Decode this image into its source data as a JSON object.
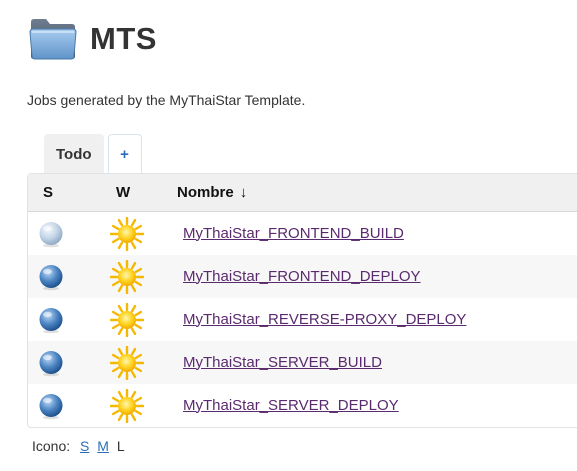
{
  "view": {
    "title": "MTS",
    "description": "Jobs generated by the MyThaiStar Template."
  },
  "tabs": {
    "active_label": "Todo",
    "add_label": "+"
  },
  "table": {
    "headers": {
      "status": "S",
      "weather": "W",
      "name": "Nombre",
      "sort_indicator": "↓"
    },
    "rows": [
      {
        "name": "MyThaiStar_FRONTEND_BUILD",
        "status": "disabled",
        "weather": "sunny"
      },
      {
        "name": "MyThaiStar_FRONTEND_DEPLOY",
        "status": "success",
        "weather": "sunny"
      },
      {
        "name": "MyThaiStar_REVERSE-PROXY_DEPLOY",
        "status": "success",
        "weather": "sunny"
      },
      {
        "name": "MyThaiStar_SERVER_BUILD",
        "status": "success",
        "weather": "sunny"
      },
      {
        "name": "MyThaiStar_SERVER_DEPLOY",
        "status": "success",
        "weather": "sunny"
      }
    ]
  },
  "icon_size": {
    "label": "Icono:",
    "small": "S",
    "medium": "M",
    "large": "L"
  },
  "colors": {
    "success_ball": "#2f6fb3",
    "disabled_ball": "#a9c3de",
    "sun": "#f7c21a",
    "link": "#5a2a6e"
  },
  "icons": {
    "header": "folder-icon",
    "status": "status-ball-icon",
    "weather": "sun-icon"
  }
}
